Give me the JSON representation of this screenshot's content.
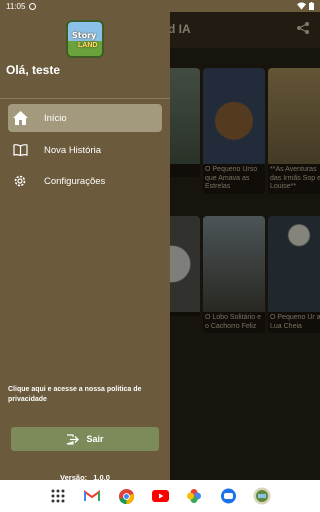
{
  "status_bar": {
    "time": "11:05"
  },
  "app": {
    "title_visible": "d IA",
    "cards": [
      {
        "caption": "nos e o"
      },
      {
        "caption": "O Pequeno Urso que Amava as Estrelas"
      },
      {
        "caption": "**As Aventuras das Irmãs Sop e Louise**"
      },
      {
        "caption": ""
      },
      {
        "caption": "O Lobo Solitário e o Cachorro Feliz"
      },
      {
        "caption": "O Pequeno Ur a Lua Cheia"
      }
    ]
  },
  "drawer": {
    "greeting": "Olá, teste",
    "menu": [
      {
        "label": "Início",
        "icon": "home-icon",
        "active": true
      },
      {
        "label": "Nova História",
        "icon": "book-icon",
        "active": false
      },
      {
        "label": "Configurações",
        "icon": "gear-icon",
        "active": false
      }
    ],
    "privacy_text": "Clique aqui e acesse a nossa politica de privacidade",
    "logout_label": "Sair",
    "version_label": "Versão:",
    "version_value": "1.0.0"
  },
  "colors": {
    "drawer_bg": "#6b5a3c",
    "active_item": "#a39a7d",
    "logout_bg": "#7d8a5a"
  }
}
